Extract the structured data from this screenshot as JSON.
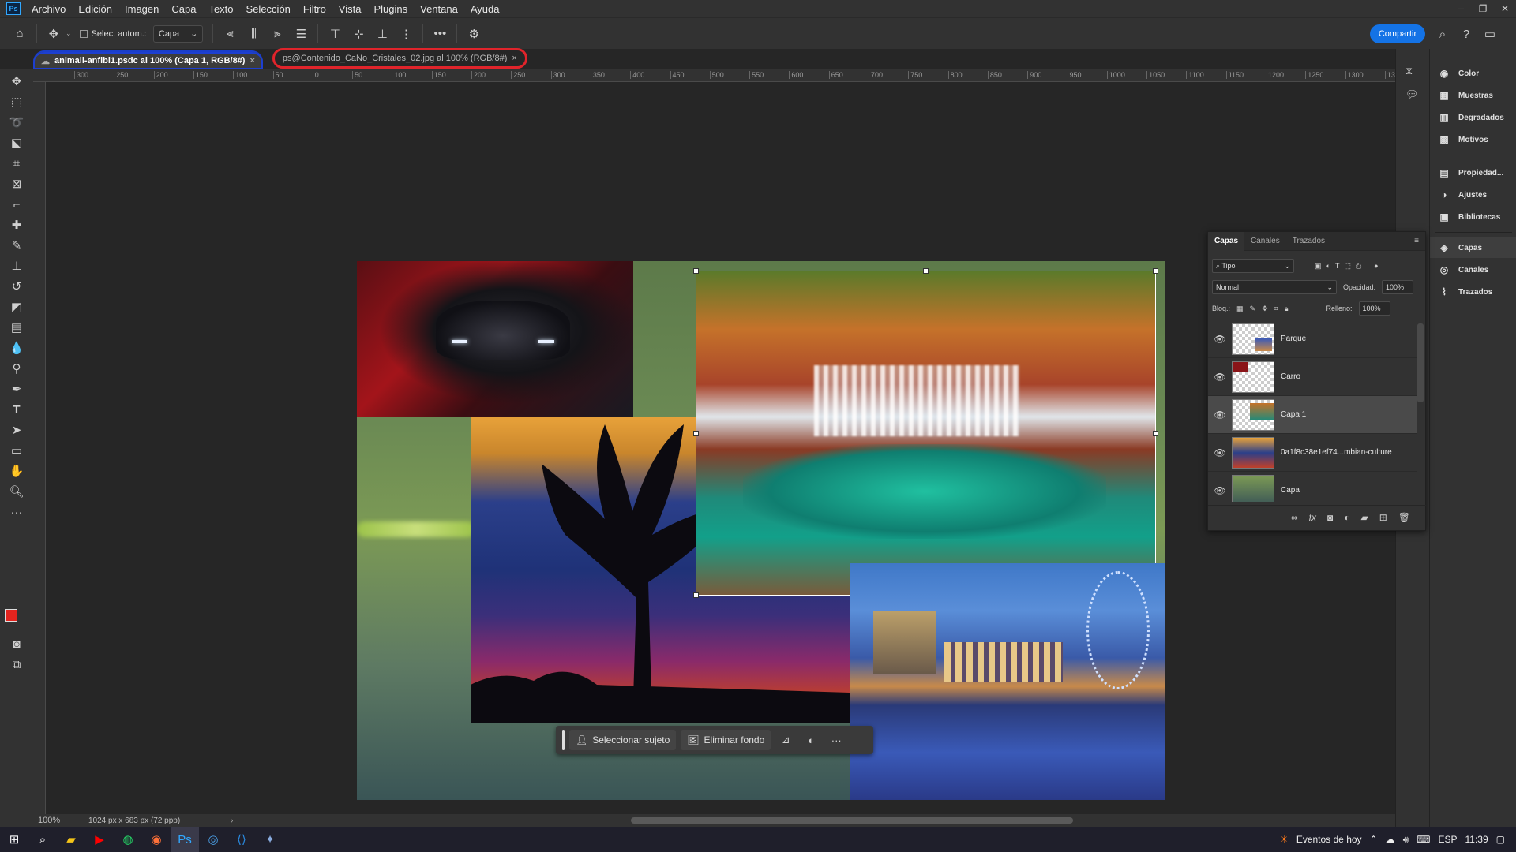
{
  "app": {
    "logo": "Ps"
  },
  "menu": [
    "Archivo",
    "Edición",
    "Imagen",
    "Capa",
    "Texto",
    "Selección",
    "Filtro",
    "Vista",
    "Plugins",
    "Ventana",
    "Ayuda"
  ],
  "options": {
    "auto_select_label": "Selec. autom.:",
    "auto_select_value": "Capa",
    "share_label": "Compartir"
  },
  "tabs": [
    {
      "label": "animali-anfibi1.psdc al 100% (Capa 1, RGB/8#)",
      "close": "×"
    },
    {
      "label": "ps@Contenido_CaNo_Cristales_02.jpg al 100% (RGB/8#)",
      "close": "×"
    }
  ],
  "ruler_ticks": [
    "300",
    "250",
    "200",
    "150",
    "100",
    "50",
    "0",
    "50",
    "100",
    "150",
    "200",
    "250",
    "300",
    "350",
    "400",
    "450",
    "500",
    "550",
    "600",
    "650",
    "700",
    "750",
    "800",
    "850",
    "900",
    "950",
    "1000",
    "1050",
    "1100",
    "1150",
    "1200",
    "1250",
    "1300",
    "13"
  ],
  "context_bar": {
    "select_subject": "Seleccionar sujeto",
    "remove_background": "Eliminar fondo",
    "more": "···"
  },
  "status": {
    "zoom": "100%",
    "doc_info": "1024 px x 683 px (72 ppp)"
  },
  "right_panel": {
    "group1": [
      "Color",
      "Muestras",
      "Degradados",
      "Motivos"
    ],
    "group2": [
      "Propiedad...",
      "Ajustes",
      "Bibliotecas"
    ],
    "group3": [
      "Capas",
      "Canales",
      "Trazados"
    ]
  },
  "layers_panel": {
    "tabs": [
      "Capas",
      "Canales",
      "Trazados"
    ],
    "filter": "Tipo",
    "blend_mode": "Normal",
    "opacity_label": "Opacidad:",
    "opacity_value": "100%",
    "lock_label": "Bloq.:",
    "fill_label": "Relleno:",
    "fill_value": "100%",
    "layers": [
      {
        "name": "Parque",
        "selected": false
      },
      {
        "name": "Carro",
        "selected": false
      },
      {
        "name": "Capa 1",
        "selected": true
      },
      {
        "name": "0a1f8c38e1ef74...mbian-culture",
        "selected": false
      },
      {
        "name": "Capa",
        "selected": false
      }
    ]
  },
  "taskbar": {
    "events": "Eventos de hoy",
    "lang": "ESP",
    "time": "11:39"
  },
  "colors": {
    "accent": "#1473e6",
    "fg_color": "#e3241e",
    "bg_color": "#ffffff",
    "tab1_outline": "#1d3fd0",
    "tab2_outline": "#e0242b"
  }
}
